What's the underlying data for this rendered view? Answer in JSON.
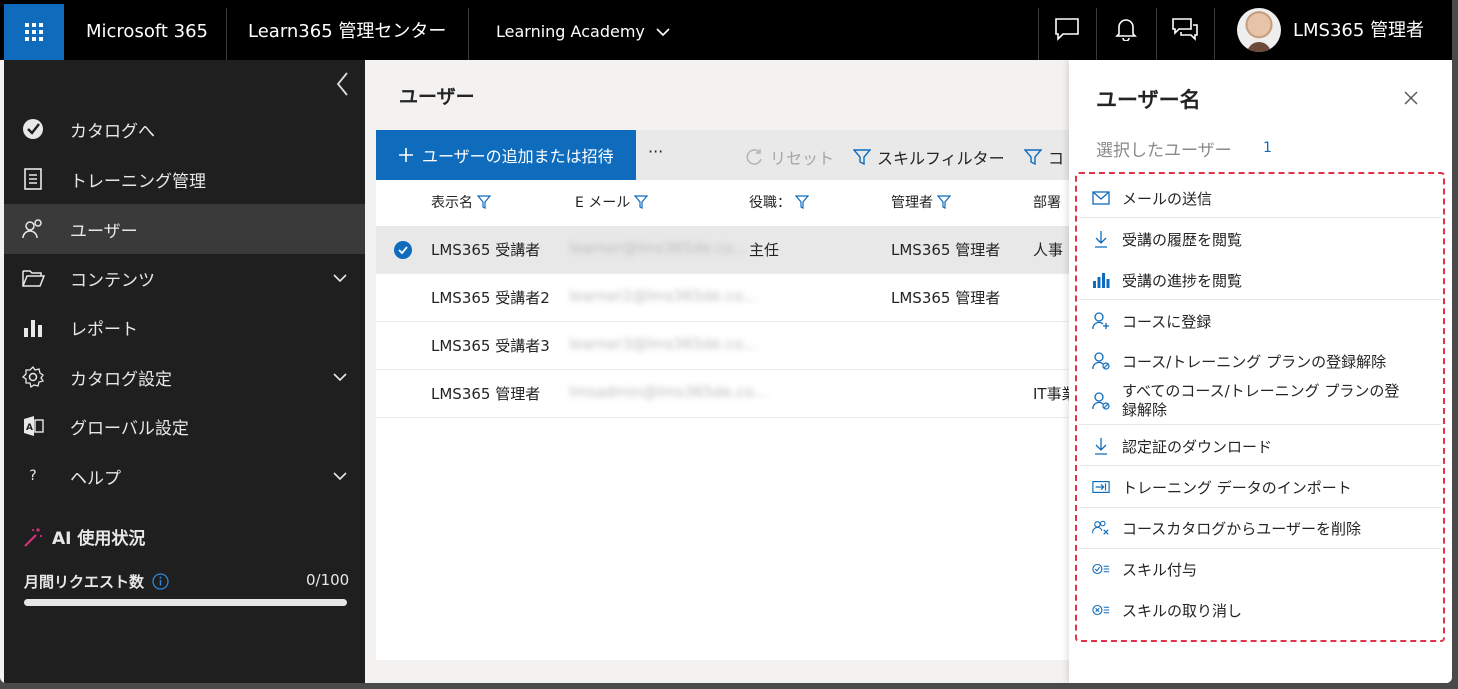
{
  "header": {
    "suite": "Microsoft 365",
    "app": "Learn365 管理センター",
    "tenant": "Learning Academy",
    "user": "LMS365 管理者"
  },
  "sidebar": {
    "items": [
      {
        "label": "カタログへ",
        "icon": "catalog-check-icon"
      },
      {
        "label": "トレーニング管理",
        "icon": "clipboard-icon"
      },
      {
        "label": "ユーザー",
        "icon": "users-icon",
        "active": true
      },
      {
        "label": "コンテンツ",
        "icon": "folder-icon",
        "expandable": true
      },
      {
        "label": "レポート",
        "icon": "bar-chart-icon"
      },
      {
        "label": "カタログ設定",
        "icon": "gear-icon",
        "expandable": true
      },
      {
        "label": "グローバル設定",
        "icon": "admin-icon"
      },
      {
        "label": "ヘルプ",
        "icon": "question-icon",
        "expandable": true
      }
    ],
    "ai_usage_title": "AI 使用状況",
    "monthly_requests_label": "月間リクエスト数",
    "monthly_requests_value": "0/100",
    "monthly_requests_fraction": 0
  },
  "main": {
    "title": "ユーザー",
    "add_button": "ユーザーの追加または招待",
    "more": "···",
    "reset": "リセット",
    "skill_filter": "スキルフィルター",
    "cut_filter": "コ",
    "columns": [
      "表示名",
      "E メール",
      "役職：",
      "管理者",
      "部署"
    ],
    "rows": [
      {
        "name": "LMS365 受講者",
        "email": "learner@lms365de.co...",
        "title": "主任",
        "manager": "LMS365 管理者",
        "dept": "人事",
        "selected": true
      },
      {
        "name": "LMS365 受講者2",
        "email": "learner2@lms365de.co...",
        "title": "",
        "manager": "LMS365 管理者",
        "dept": "",
        "selected": false
      },
      {
        "name": "LMS365 受講者3",
        "email": "learner3@lms365de.co...",
        "title": "",
        "manager": "",
        "dept": "",
        "selected": false
      },
      {
        "name": "LMS365 管理者",
        "email": "lmsadmin@lms365de.co...",
        "title": "",
        "manager": "",
        "dept": "IT事業",
        "selected": false
      }
    ]
  },
  "panel": {
    "title": "ユーザー名",
    "selected_label": "選択したユーザー",
    "selected_count": "1",
    "actions": [
      {
        "label": "メールの送信",
        "icon": "mail-send-icon"
      },
      {
        "label": "受講の履歴を閲覧",
        "icon": "download-arrow-icon"
      },
      {
        "label": "受講の進捗を閲覧",
        "icon": "bar-chart-icon"
      },
      {
        "label": "コースに登録",
        "icon": "person-add-icon"
      },
      {
        "label": "コース/トレーニング プランの登録解除",
        "icon": "person-remove-icon"
      },
      {
        "label": "すべてのコース/トレーニング プランの登録解除",
        "icon": "person-remove-icon"
      },
      {
        "label": "認定証のダウンロード",
        "icon": "download-arrow-icon"
      },
      {
        "label": "トレーニング データのインポート",
        "icon": "import-icon"
      },
      {
        "label": "コースカタログからユーザーを削除",
        "icon": "people-delete-icon"
      },
      {
        "label": "スキル付与",
        "icon": "skill-grant-icon"
      },
      {
        "label": "スキルの取り消し",
        "icon": "skill-revoke-icon"
      }
    ]
  },
  "colors": {
    "accent": "#0f6cbd",
    "topbar": "#000000",
    "sidebar": "#1f1f1f",
    "highlight_border": "#e0334a"
  }
}
